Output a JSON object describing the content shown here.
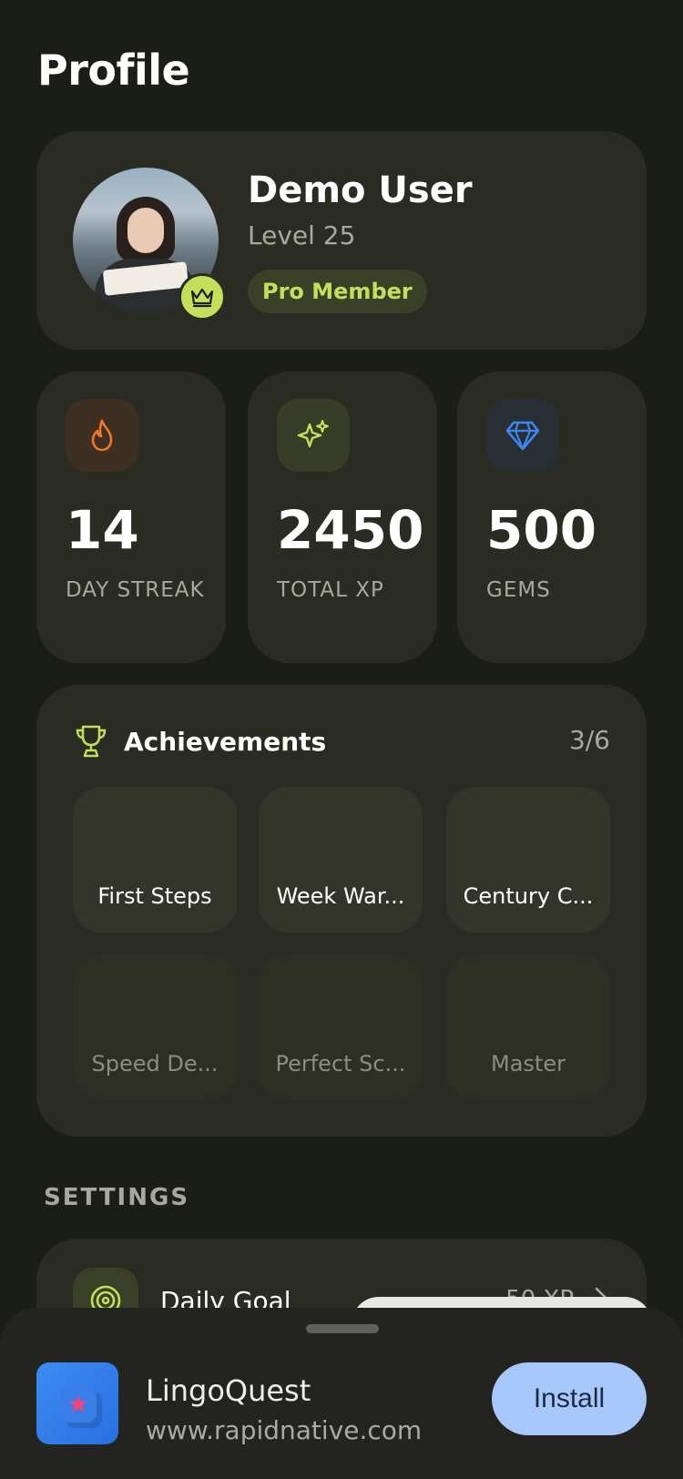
{
  "page": {
    "title": "Profile"
  },
  "profile": {
    "name": "Demo User",
    "level": "Level 25",
    "membership": "Pro Member",
    "badge_icon": "crown-icon"
  },
  "stats": [
    {
      "value": "14",
      "label": "DAY STREAK",
      "icon": "flame-icon",
      "icon_color": "#f0762b",
      "icon_bg": "#3e2f23"
    },
    {
      "value": "2450",
      "label": "TOTAL XP",
      "icon": "sparkle-icon",
      "icon_color": "#c4e05a",
      "icon_bg": "#383d27"
    },
    {
      "value": "500",
      "label": "GEMS",
      "icon": "gem-icon",
      "icon_color": "#3d86f0",
      "icon_bg": "#272f34"
    }
  ],
  "achievements": {
    "title": "Achievements",
    "count": "3/6",
    "items": [
      {
        "label": "First Steps",
        "unlocked": true
      },
      {
        "label": "Week War...",
        "unlocked": true
      },
      {
        "label": "Century C...",
        "unlocked": true
      },
      {
        "label": "Speed De...",
        "unlocked": false
      },
      {
        "label": "Perfect Sc...",
        "unlocked": false
      },
      {
        "label": "Master",
        "unlocked": false
      }
    ]
  },
  "settings": {
    "heading": "SETTINGS",
    "items": [
      {
        "label": "Daily Goal",
        "value": "50 XP",
        "icon": "target-icon"
      }
    ]
  },
  "install_banner": {
    "app_name": "LingoQuest",
    "url": "www.rapidnative.com",
    "button_label": "Install"
  },
  "colors": {
    "background": "#1b1e16",
    "card": "#2a2c23",
    "accent": "#c4e05a",
    "install_button": "#a8c7fa"
  }
}
